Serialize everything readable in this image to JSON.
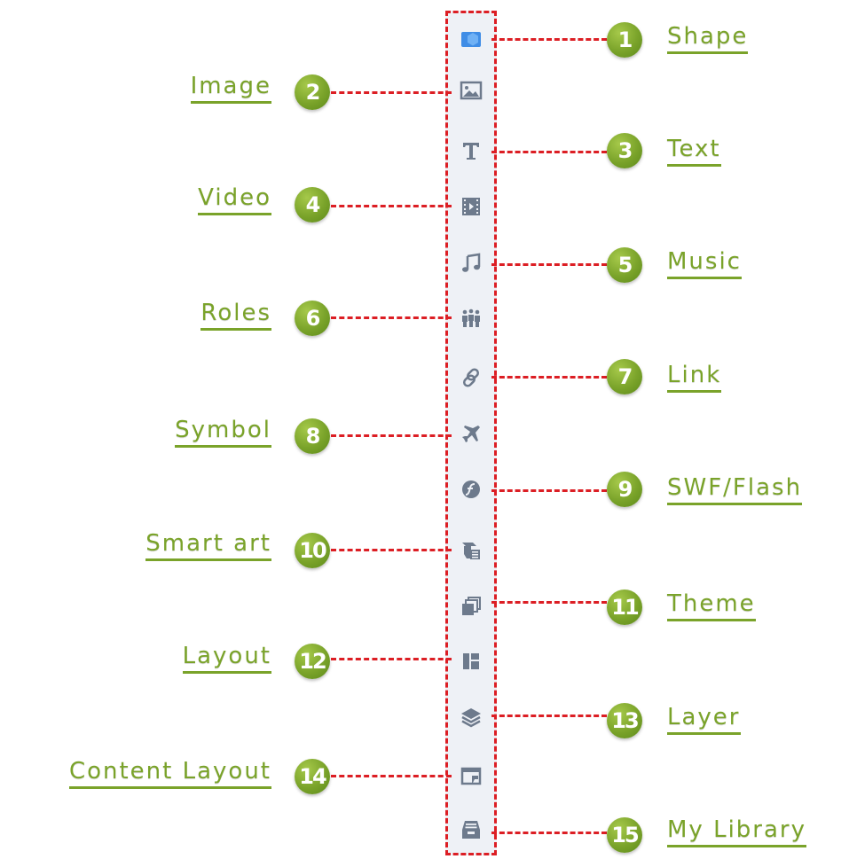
{
  "diagram": {
    "colors": {
      "leader": "#dc1e24",
      "badge": "#7aa32a",
      "label": "#7aa32a",
      "icon": "#6d7a8c",
      "active_icon": "#3f8de6",
      "toolbar": "#eef1f6"
    },
    "items": [
      {
        "number": "1",
        "label": "Shape",
        "icon": "shape-icon"
      },
      {
        "number": "2",
        "label": "Image",
        "icon": "image-icon"
      },
      {
        "number": "3",
        "label": "Text",
        "icon": "text-icon"
      },
      {
        "number": "4",
        "label": "Video",
        "icon": "video-icon"
      },
      {
        "number": "5",
        "label": "Music",
        "icon": "music-icon"
      },
      {
        "number": "6",
        "label": "Roles",
        "icon": "roles-icon"
      },
      {
        "number": "7",
        "label": "Link",
        "icon": "link-icon"
      },
      {
        "number": "8",
        "label": "Symbol",
        "icon": "plane-icon"
      },
      {
        "number": "9",
        "label": "SWF/Flash",
        "icon": "flash-icon"
      },
      {
        "number": "10",
        "label": "Smart art",
        "icon": "smart-art-icon"
      },
      {
        "number": "11",
        "label": "Theme",
        "icon": "theme-icon"
      },
      {
        "number": "12",
        "label": "Layout",
        "icon": "layout-icon"
      },
      {
        "number": "13",
        "label": "Layer",
        "icon": "layers-icon"
      },
      {
        "number": "14",
        "label": "Content Layout",
        "icon": "content-layout-icon"
      },
      {
        "number": "15",
        "label": "My Library",
        "icon": "library-icon"
      }
    ]
  }
}
